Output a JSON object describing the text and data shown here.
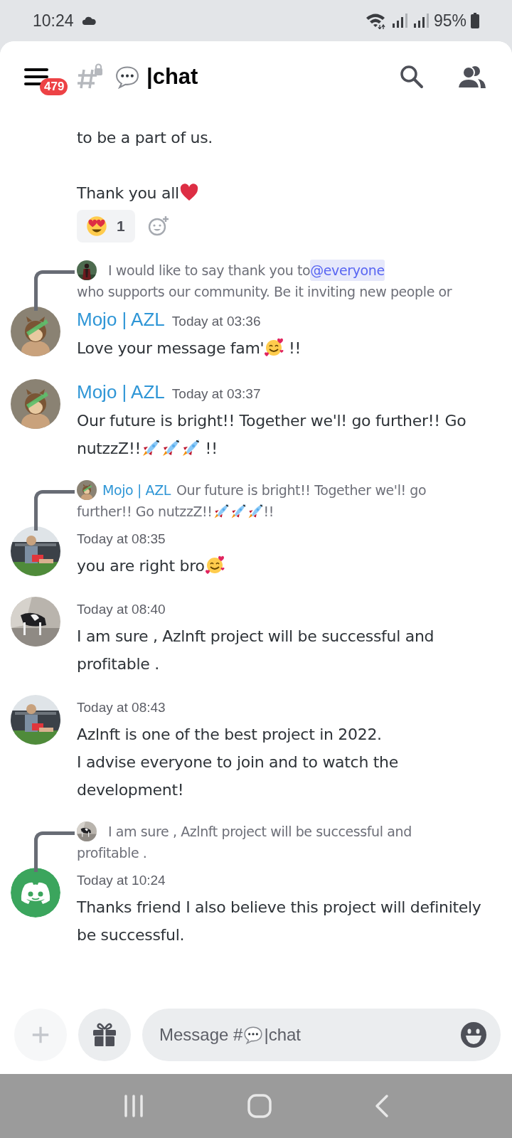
{
  "status_bar": {
    "time": "10:24",
    "battery": "95%"
  },
  "header": {
    "notification_count": "479",
    "channel": "|chat"
  },
  "messages": [
    {
      "kind": "continuation",
      "paragraphs": [
        [
          {
            "parts": [
              {
                "kind": "text",
                "text": "to be a part of us."
              }
            ]
          }
        ],
        [
          {
            "parts": [
              {
                "kind": "text",
                "text": "Thank you all"
              },
              {
                "kind": "heart"
              }
            ]
          }
        ]
      ],
      "reactions": [
        {
          "count": "1",
          "selected": false
        }
      ]
    },
    {
      "kind": "message",
      "reply": {
        "avatar": {
          "kind": "picture"
        },
        "lines": [
          [
            {
              "kind": "text",
              "text": "I would like to say thank you to "
            },
            {
              "kind": "mention",
              "text": "@everyone"
            }
          ],
          [
            {
              "kind": "text",
              "text": "who supports our community. Be it inviting new people or"
            }
          ]
        ]
      },
      "avatar": {
        "kind": "picture"
      },
      "author": "Mojo | AZL",
      "timestamp": "Today at 03:36",
      "paragraphs": [
        [
          {
            "parts": [
              {
                "kind": "text",
                "text": "Love your message fam'"
              },
              {
                "kind": "hearts_face"
              },
              {
                "kind": "text",
                "text": " !!"
              }
            ]
          }
        ]
      ]
    },
    {
      "kind": "message",
      "avatar": {
        "kind": "picture"
      },
      "author": "Mojo | AZL",
      "timestamp": "Today at 03:37",
      "paragraphs": [
        [
          {
            "parts": [
              {
                "kind": "text",
                "text": "Our future is bright!! Together we'l! go further!! Go"
              }
            ]
          },
          {
            "parts": [
              {
                "kind": "text",
                "text": "nutzzZ!!"
              },
              {
                "kind": "rocket"
              },
              {
                "kind": "rocket"
              },
              {
                "kind": "rocket"
              },
              {
                "kind": "text",
                "text": " !!"
              }
            ]
          }
        ]
      ]
    },
    {
      "kind": "message",
      "reply": {
        "avatar": {
          "kind": "picture"
        },
        "author": "Mojo | AZL",
        "lines": [
          [
            {
              "kind": "text",
              "text": "Our future is bright!! Together we'l! go"
            }
          ],
          [
            {
              "kind": "text",
              "text": "further!! Go nutzzZ!!"
            },
            {
              "kind": "rocket"
            },
            {
              "kind": "rocket"
            },
            {
              "kind": "rocket"
            },
            {
              "kind": "text",
              "text": " !!"
            }
          ]
        ]
      },
      "avatar": {
        "kind": "picture"
      },
      "timestamp": "Today at 08:35",
      "paragraphs": [
        [
          {
            "parts": [
              {
                "kind": "text",
                "text": "you are right bro"
              },
              {
                "kind": "hearts_face"
              }
            ]
          }
        ]
      ]
    },
    {
      "kind": "message",
      "avatar": {
        "kind": "picture"
      },
      "timestamp": "Today at 08:40",
      "paragraphs": [
        [
          {
            "parts": [
              {
                "kind": "text",
                "text": "I am sure , Azlnft project will be successful and profitable ."
              }
            ]
          }
        ]
      ]
    },
    {
      "kind": "message",
      "avatar": {
        "kind": "picture"
      },
      "timestamp": "Today at 08:43",
      "paragraphs": [
        [
          {
            "parts": [
              {
                "kind": "text",
                "text": "Azlnft is one of the best project in 2022."
              }
            ]
          },
          {
            "parts": [
              {
                "kind": "text",
                "text": "I advise everyone to join and to watch the development!"
              }
            ]
          }
        ]
      ]
    },
    {
      "kind": "message",
      "reply": {
        "avatar": {
          "kind": "picture"
        },
        "lines": [
          [
            {
              "kind": "text",
              "text": "I am sure , Azlnft project will be successful and"
            }
          ],
          [
            {
              "kind": "text",
              "text": "profitable ."
            }
          ]
        ]
      },
      "avatar": {
        "kind": "default"
      },
      "timestamp": "Today at 10:24",
      "paragraphs": [
        [
          {
            "parts": [
              {
                "kind": "text",
                "text": "Thanks friend I also believe this project will definitely be successful."
              }
            ]
          }
        ]
      ]
    }
  ],
  "composer": {
    "placeholder": [
      {
        "kind": "text",
        "text": "Message #"
      },
      {
        "kind": "bubble"
      },
      {
        "kind": "text",
        "text": "|chat"
      }
    ]
  }
}
